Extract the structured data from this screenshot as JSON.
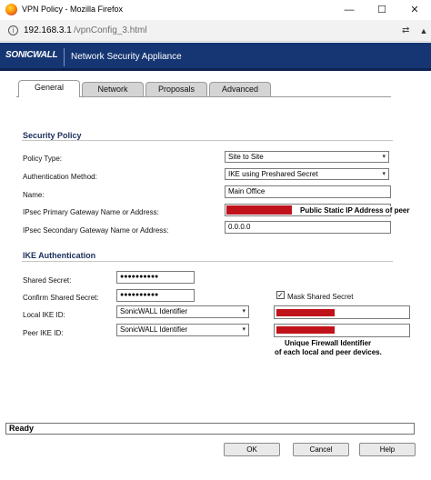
{
  "window": {
    "title": "VPN Policy - Mozilla Firefox",
    "minimize_glyph": "—",
    "maximize_glyph": "☐",
    "close_glyph": "✕",
    "icon": "firefox-icon"
  },
  "address_bar": {
    "host": "192.168.3.1",
    "path": "/vpnConfig_3.html",
    "info_glyph": "i",
    "tools_glyph": "⇄",
    "scroll_glyph": "▲"
  },
  "banner": {
    "logo": "SONICWALL",
    "product": "Network Security Appliance",
    "color": "#153673"
  },
  "tabs": [
    {
      "label": "General",
      "active": true
    },
    {
      "label": "Network",
      "active": false
    },
    {
      "label": "Proposals",
      "active": false
    },
    {
      "label": "Advanced",
      "active": false
    }
  ],
  "security_policy": {
    "title": "Security Policy",
    "policy_type": {
      "label": "Policy Type:",
      "value": "Site to Site"
    },
    "auth_method": {
      "label": "Authentication Method:",
      "value": "IKE using Preshared Secret"
    },
    "name": {
      "label": "Name:",
      "value": "Main Office"
    },
    "primary_gateway": {
      "label": "IPsec Primary Gateway Name or Address:",
      "value": "",
      "annotation": "Public Static IP Address of peer"
    },
    "secondary_gateway": {
      "label": "IPsec Secondary Gateway Name or Address:",
      "value": "0.0.0.0"
    }
  },
  "ike_auth": {
    "title": "IKE Authentication",
    "shared_secret": {
      "label": "Shared Secret:",
      "value": "●●●●●●●●●●"
    },
    "confirm_secret": {
      "label": "Confirm Shared Secret:",
      "value": "●●●●●●●●●●"
    },
    "mask_secret": {
      "label": "Mask Shared Secret",
      "checked": true,
      "glyph": "✓"
    },
    "local_ike_id": {
      "label": "Local IKE ID:",
      "value": "SonicWALL Identifier"
    },
    "peer_ike_id": {
      "label": "Peer IKE ID:",
      "value": "SonicWALL Identifier"
    },
    "annotation_line1": "Unique Firewall Identifier",
    "annotation_line2": "of each local and peer devices."
  },
  "redaction_color": "#c0121a",
  "status": {
    "text": "Ready"
  },
  "buttons": {
    "ok": "OK",
    "cancel": "Cancel",
    "help": "Help"
  },
  "chevron_glyph": "▾"
}
